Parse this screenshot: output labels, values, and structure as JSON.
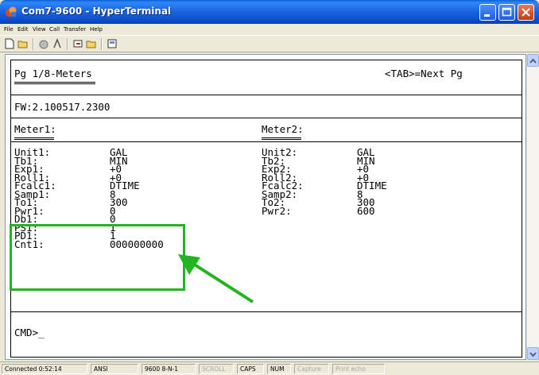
{
  "window": {
    "title": "Com7-9600 - HyperTerminal"
  },
  "menu": [
    "File",
    "Edit",
    "View",
    "Call",
    "Transfer",
    "Help"
  ],
  "toolbar": [
    "new-icon",
    "open-icon",
    "disconnect-icon",
    "connect-icon",
    "send-icon",
    "receive-icon",
    "properties-icon"
  ],
  "terminal": {
    "page_title": "Pg 1/8-Meters",
    "next_hint": "<TAB>=Next Pg",
    "firmware": "FW:2.100517.2300",
    "meter1": {
      "header": "Meter1:",
      "rows": [
        {
          "label": "Unit1:",
          "value": "GAL"
        },
        {
          "label": "Tb1:",
          "value": "MIN"
        },
        {
          "label": "Exp1:",
          "value": "+0"
        },
        {
          "label": "Roll1:",
          "value": "+0"
        },
        {
          "label": "Fcalc1:",
          "value": "DTIME"
        },
        {
          "label": "Samp1:",
          "value": "8"
        },
        {
          "label": "To1:",
          "value": "300"
        },
        {
          "label": "Pwr1:",
          "value": "0"
        },
        {
          "label": "Db1:",
          "value": "0"
        },
        {
          "label": "PS1:",
          "value": "1"
        },
        {
          "label": "PD1:",
          "value": "1"
        },
        {
          "label": "Cnt1:",
          "value": "000000000"
        }
      ]
    },
    "meter2": {
      "header": "Meter2:",
      "rows": [
        {
          "label": "Unit2:",
          "value": "GAL"
        },
        {
          "label": "Tb2:",
          "value": "MIN"
        },
        {
          "label": "Exp2:",
          "value": "+0"
        },
        {
          "label": "Roll2:",
          "value": "+0"
        },
        {
          "label": "Fcalc2:",
          "value": "DTIME"
        },
        {
          "label": "Samp2:",
          "value": "8"
        },
        {
          "label": "To2:",
          "value": "300"
        },
        {
          "label": "Pwr2:",
          "value": "600"
        }
      ]
    },
    "prompt": "CMD>_"
  },
  "status": {
    "connected": "Connected 0:52:14",
    "emulation": "ANSI",
    "settings": "9600 8-N-1",
    "scroll": "SCROLL",
    "caps": "CAPS",
    "num": "NUM",
    "capture": "Capture",
    "print_echo": "Print echo"
  },
  "colors": {
    "annotation": "#22b422",
    "titlebar": "#0a5fd8"
  }
}
